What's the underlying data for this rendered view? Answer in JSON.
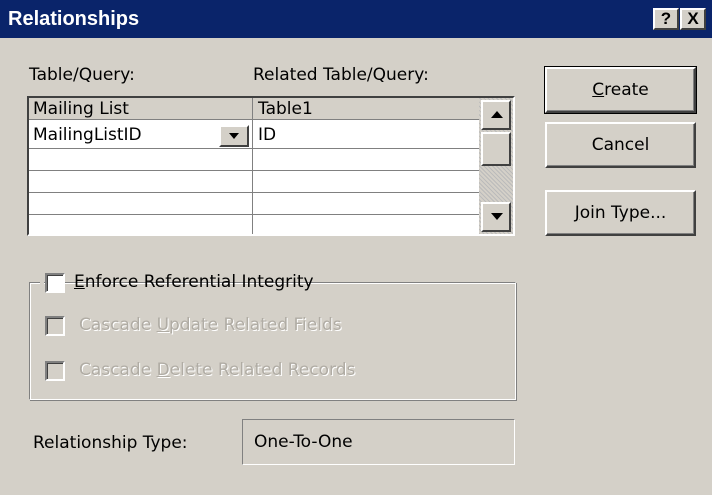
{
  "window": {
    "title": "Relationships",
    "help_label": "?",
    "close_label": "X"
  },
  "labels": {
    "table_query": "Table/Query:",
    "related_table_query": "Related Table/Query:"
  },
  "grid": {
    "headers": [
      "Mailing List",
      "Table1"
    ],
    "rows": [
      [
        "MailingListID",
        "ID"
      ],
      [
        "",
        ""
      ],
      [
        "",
        ""
      ],
      [
        "",
        ""
      ]
    ]
  },
  "buttons": {
    "create": {
      "mnemonic": "C",
      "rest": "reate"
    },
    "cancel": "Cancel",
    "join_type": {
      "mnemonic": "J",
      "rest": "oin Type..."
    }
  },
  "options": {
    "enforce": {
      "mnemonic": "E",
      "rest": "nforce Referential Integrity",
      "checked": false
    },
    "cascade_update": {
      "pre": "Cascade ",
      "mnemonic": "U",
      "rest": "pdate Related Fields",
      "checked": false,
      "enabled": false
    },
    "cascade_delete": {
      "pre": "Cascade ",
      "mnemonic": "D",
      "rest": "elete Related Records",
      "checked": false,
      "enabled": false
    }
  },
  "relationship": {
    "label": "Relationship Type:",
    "value": "One-To-One"
  },
  "colors": {
    "face": "#d4d0c8",
    "title_bar": "#0a246a"
  }
}
